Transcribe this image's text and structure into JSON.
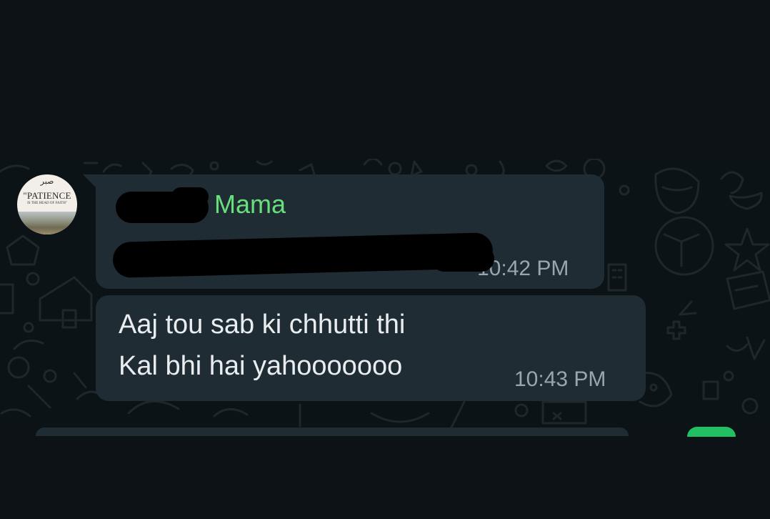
{
  "avatar": {
    "script_text": "صبر",
    "title": "\"PATIENCE",
    "subtitle": "IS THE HEAD OF FAITH\""
  },
  "messages": [
    {
      "sender": "Mama",
      "text": "",
      "time": "10:42 PM",
      "redacted": true
    },
    {
      "sender": "",
      "text": "Aaj tou sab ki chhutti thi\nKal bhi hai yahooooooo",
      "time": "10:43 PM",
      "redacted": false
    }
  ],
  "colors": {
    "background": "#0c1317",
    "bubble": "#202c33",
    "sender_name": "#67e07c",
    "message_text": "#e9edef",
    "timestamp": "#9aa6ad",
    "send_button": "#21c063"
  },
  "icons": [
    "contact-avatar",
    "send-icon"
  ]
}
